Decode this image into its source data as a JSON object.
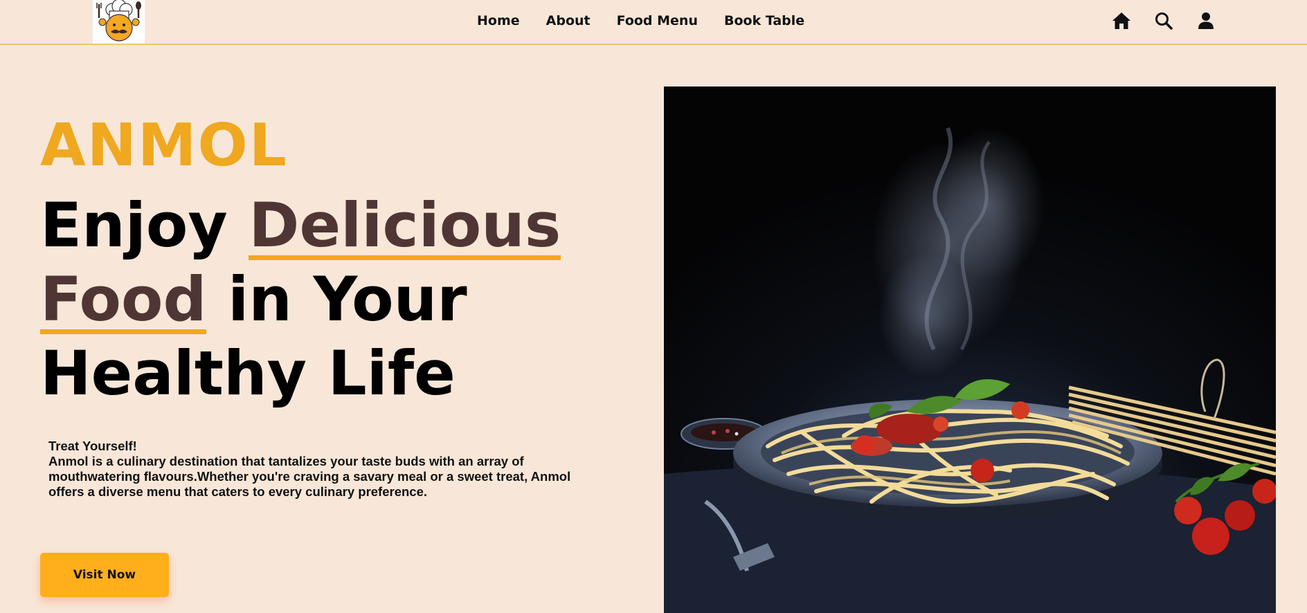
{
  "header": {
    "logo_icon": "chef-mascot-logo",
    "nav": [
      {
        "label": "Home"
      },
      {
        "label": "About"
      },
      {
        "label": "Food Menu"
      },
      {
        "label": "Book Table"
      }
    ],
    "icons": [
      "home-icon",
      "search-icon",
      "user-icon"
    ]
  },
  "hero": {
    "brand": "ANMOL",
    "headline": {
      "part1": "Enjoy ",
      "accent1": "Delicious",
      "accent2": "Food",
      "part2": " in Your",
      "part3": "Healthy Life"
    },
    "tagline": "Treat Yourself!",
    "description": "Anmol is a culinary destination that tantalizes your taste buds with an array of mouthwatering flavours.Whether you're craving a savary meal or a sweet treat, Anmol offers a diverse menu that caters to every culinary preference.",
    "cta_label": "Visit Now",
    "image": "spaghetti-plate-photo"
  },
  "colors": {
    "background": "#f8e7d8",
    "accent_orange": "#efa81f",
    "accent_brown": "#4f3634",
    "button": "#ffae1c",
    "header_border": "#f4c37a"
  }
}
